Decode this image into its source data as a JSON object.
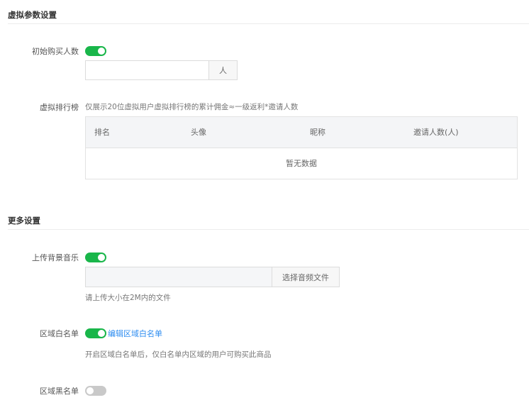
{
  "virtual_section": {
    "title": "虚拟参数设置",
    "initial_buyers": {
      "label": "初始购买人数",
      "enabled": true,
      "value": "",
      "unit": "人"
    },
    "virtual_ranking": {
      "label": "虚拟排行榜",
      "description": "仅展示20位虚拟用户虚拟排行榜的累计佣金≈一级返利*邀请人数",
      "columns": [
        "排名",
        "头像",
        "昵称",
        "邀请人数(人)"
      ],
      "empty_text": "暂无数据"
    }
  },
  "more_section": {
    "title": "更多设置",
    "background_music": {
      "label": "上传背景音乐",
      "enabled": true,
      "button_label": "选择音频文件",
      "hint": "请上传大小在2M内的文件"
    },
    "region_whitelist": {
      "label": "区域白名单",
      "enabled": true,
      "edit_link": "编辑区域白名单",
      "hint": "开启区域白名单后，仅白名单内区域的用户可购买此商品"
    },
    "region_blacklist": {
      "label": "区域黑名单",
      "enabled": false
    }
  },
  "colors": {
    "accent_green": "#19b64a",
    "link_blue": "#2d8cf0",
    "toggle_off": "#c9c9c9"
  }
}
